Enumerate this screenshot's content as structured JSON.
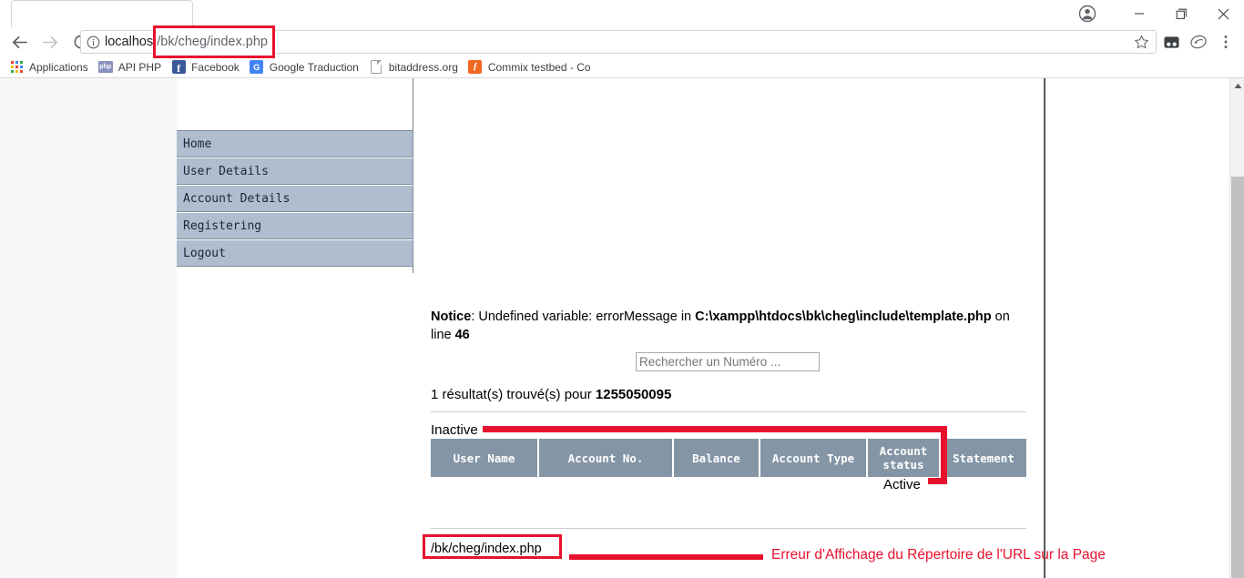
{
  "browser": {
    "window_controls": {
      "profile": "profile-avatar",
      "minimize": "minimize",
      "maximize": "maximize",
      "close": "close"
    },
    "nav": {
      "back": "Back",
      "forward": "Forward",
      "reload": "Reload"
    },
    "omnibox": {
      "security_icon": "info-circle",
      "url_host": "localhost",
      "url_path": "/bk/cheg/index.php",
      "full_url": "localhost/bk/cheg/index.php",
      "bookmark_star": "star",
      "highlight_color": "#e8112d"
    },
    "extensions": [
      {
        "name": "extension-dark-square",
        "glyph": "••"
      },
      {
        "name": "extension-swirl",
        "glyph": "◔"
      },
      {
        "name": "chrome-menu",
        "glyph": "⋮"
      }
    ],
    "bookmarks": [
      {
        "label": "Applications",
        "icon": "apps-grid-icon"
      },
      {
        "label": "API PHP",
        "icon": "php-icon",
        "icon_text": "php"
      },
      {
        "label": "Facebook",
        "icon": "facebook-icon",
        "icon_text": "f"
      },
      {
        "label": "Google Traduction",
        "icon": "google-translate-icon",
        "icon_text": "G"
      },
      {
        "label": "bitaddress.org",
        "icon": "document-icon"
      },
      {
        "label": "Commix testbed - Co",
        "icon": "commix-icon",
        "icon_text": "ƒ"
      }
    ]
  },
  "page": {
    "menu": {
      "items": [
        {
          "label": "Home"
        },
        {
          "label": "User Details"
        },
        {
          "label": "Account Details"
        },
        {
          "label": "Registering"
        },
        {
          "label": "Logout"
        }
      ]
    },
    "notice": {
      "label": "Notice",
      "separator": ": ",
      "message": "Undefined variable: errorMessage in ",
      "file": "C:\\xampp\\htdocs\\bk\\cheg\\include\\template.php",
      "on_line_text": " on line ",
      "line_number": "46"
    },
    "search": {
      "placeholder": "Rechercher un Numéro ...",
      "value": ""
    },
    "result": {
      "prefix": "1 résultat(s) trouvé(s) pour ",
      "query": "1255050095"
    },
    "status_message": "Inactive",
    "table": {
      "headers": [
        "User Name",
        "Account No.",
        "Balance",
        "Account Type",
        "Account status",
        "Statement"
      ],
      "rows": [
        {
          "account_status": "Active"
        }
      ]
    },
    "footer_url": "/bk/cheg/index.php"
  },
  "annotations": {
    "color": "#e8112d",
    "label": "Erreur d'Affichage du Répertoire de l'URL sur la Page"
  },
  "colors": {
    "menu_bg": "#aebece",
    "table_header_bg": "#8496a6",
    "annotation_red": "#e8112d",
    "page_bg": "#ffffff",
    "viewport_bg": "#f7f7f7"
  },
  "scrollbar": {
    "up_arrow": "scroll-up-arrow"
  }
}
